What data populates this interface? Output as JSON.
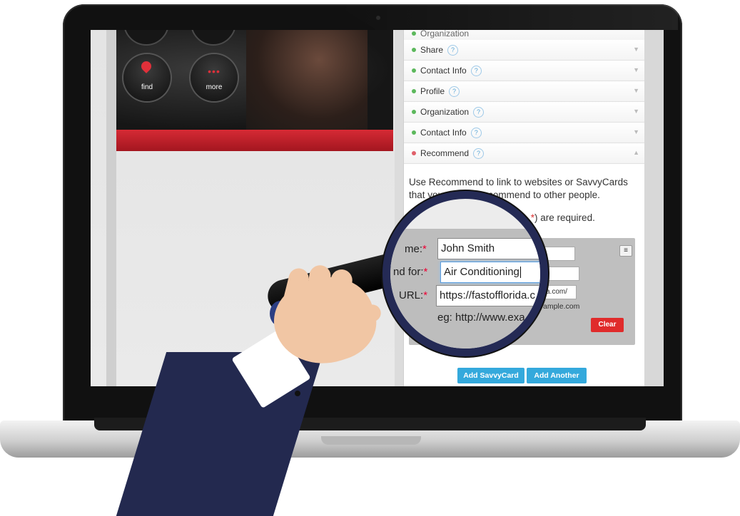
{
  "left_app": {
    "buttons": [
      {
        "label": "find",
        "icon": "map-pin-icon"
      },
      {
        "label": "more",
        "icon": "more-dots-icon"
      }
    ]
  },
  "accordion": {
    "partial_top": "Organization",
    "items": [
      {
        "label": "Share",
        "status": "green"
      },
      {
        "label": "Contact Info",
        "status": "green"
      },
      {
        "label": "Profile",
        "status": "green"
      },
      {
        "label": "Organization",
        "status": "green"
      },
      {
        "label": "Contact Info",
        "status": "green"
      },
      {
        "label": "Recommend",
        "status": "red",
        "expanded": true
      }
    ],
    "help_glyph": "?",
    "collapsed_glyph": "▼",
    "expanded_glyph": "▲"
  },
  "recommend": {
    "description": "Use Recommend to link to websites or SavvyCards that you want to recommend to other people.",
    "required_prefix": "Fie",
    "required_star": "*",
    "required_suffix": ") are required.",
    "url_visible_tail": "a.com/",
    "eg_visible_tail": "ample.com",
    "clear_label": "Clear",
    "menu_glyph": "≡",
    "add_savvycard_label": "Add SavvyCard",
    "add_another_label": "Add Another"
  },
  "magnified": {
    "name_label": "me:",
    "name_value": "John Smith",
    "recommend_label": "nd for:",
    "recommend_value": "Air Conditioning",
    "url_label": "URL:",
    "url_value": "https://fastofflorida.c",
    "eg_text": "eg: http://www.exa",
    "required_star": "*"
  },
  "colors": {
    "accent_red": "#d62a35",
    "button_blue": "#34a9dc",
    "status_green": "#5cb85c",
    "status_red": "#e0606a",
    "sleeve_navy": "#23294f"
  }
}
